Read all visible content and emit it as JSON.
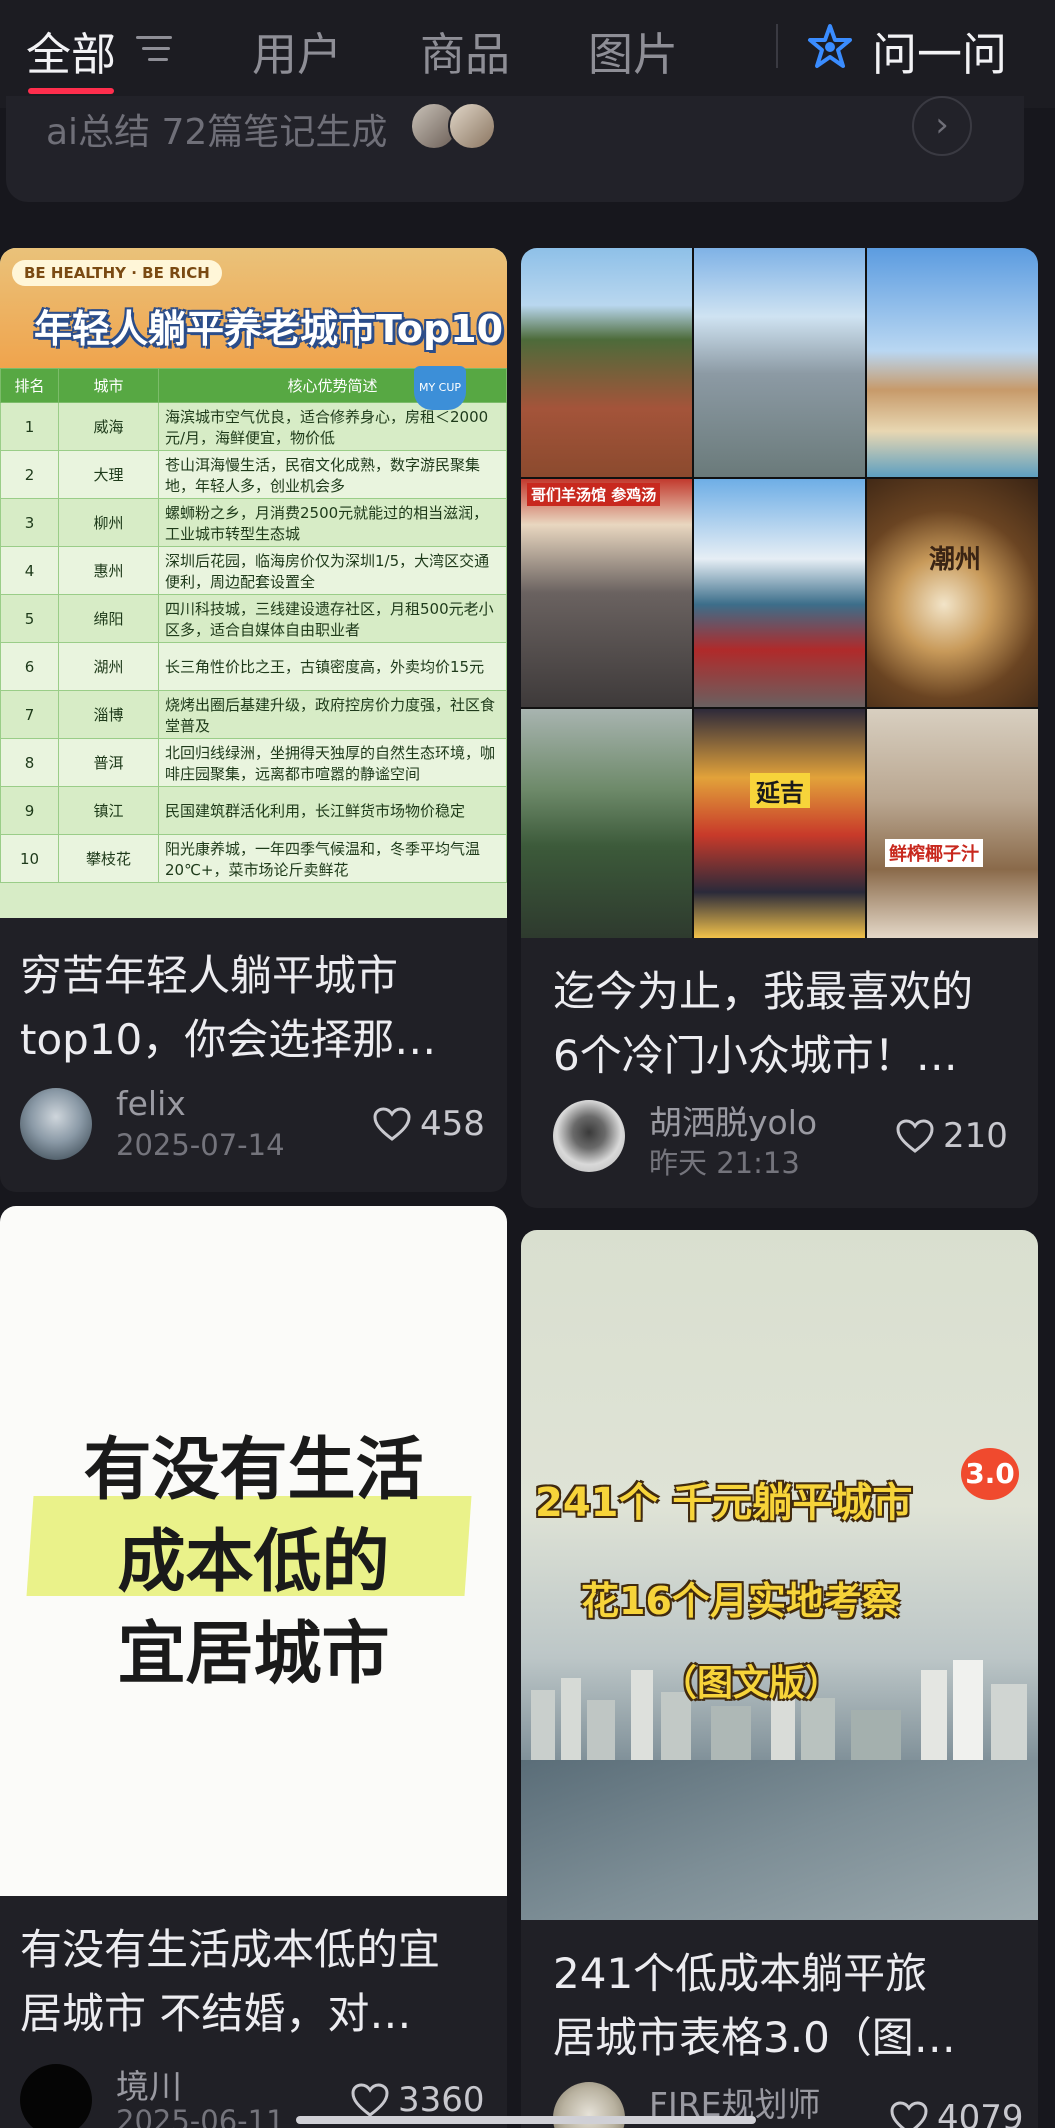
{
  "tabs": [
    {
      "label": "全部",
      "active": true
    },
    {
      "label": "用户",
      "active": false
    },
    {
      "label": "商品",
      "active": false
    },
    {
      "label": "图片",
      "active": false
    }
  ],
  "ask_label": "问一问",
  "ai_summary": {
    "text": "ai总结 72篇笔记生成"
  },
  "cards": [
    {
      "title": "穷苦年轻人躺平城市top10，你会选择那…",
      "title_lines": [
        "穷苦年轻人躺平城市",
        "top10，你会选择那…"
      ],
      "author": "felix",
      "date": "2025-07-14",
      "likes": "458",
      "image": {
        "badge": "BE HEALTHY · BE RICH",
        "heading": "年轻人躺平养老城市Top10",
        "cup_label": "MY CUP",
        "columns": [
          "排名",
          "城市",
          "核心优势简述"
        ],
        "rows": [
          [
            "1",
            "威海",
            "海滨城市空气优良，适合修养身心，房租＜2000元/月，海鲜便宜，物价低"
          ],
          [
            "2",
            "大理",
            "苍山洱海慢生活，民宿文化成熟，数字游民聚集地，年轻人多，创业机会多"
          ],
          [
            "3",
            "柳州",
            "螺蛳粉之乡，月消费2500元就能过的相当滋润，工业城市转型生态城"
          ],
          [
            "4",
            "惠州",
            "深圳后花园，临海房价仅为深圳1/5，大湾区交通便利，周边配套设置全"
          ],
          [
            "5",
            "绵阳",
            "四川科技城，三线建设遗存社区，月租500元老小区多，适合自媒体自由职业者"
          ],
          [
            "6",
            "湖州",
            "长三角性价比之王，古镇密度高，外卖均价15元"
          ],
          [
            "7",
            "淄博",
            "烧烤出圈后基建升级，政府控房价力度强，社区食堂普及"
          ],
          [
            "8",
            "普洱",
            "北回归线绿洲，坐拥得天独厚的自然生态环境，咖啡庄园聚集，远离都市喧嚣的静谧空间"
          ],
          [
            "9",
            "镇江",
            "民国建筑群活化利用，长江鲜货市场物价稳定"
          ],
          [
            "10",
            "攀枝花",
            "阳光康养城，一年四季气候温和，冬季平均气温20℃+，菜市场论斤卖鲜花"
          ]
        ]
      }
    },
    {
      "title": "迄今为止，我最喜欢的6个冷门小众城市！…",
      "title_lines": [
        "迄今为止，我最喜欢的",
        "6个冷门小众城市！…"
      ],
      "author": "胡洒脱yolo",
      "date": "昨天 21:13",
      "likes": "210",
      "image": {
        "photos": [
          {
            "subject": "buddha cliff"
          },
          {
            "subject": "street crossing"
          },
          {
            "subject": "seaside cliff"
          },
          {
            "subject": "market street",
            "sign": "哥们羊汤馆 参鸡汤"
          },
          {
            "subject": "old town buildings"
          },
          {
            "subject": "latte art",
            "sign": "潮州"
          },
          {
            "subject": "hillside village"
          },
          {
            "subject": "neon signs",
            "sign": "延吉"
          },
          {
            "subject": "coconut shop",
            "sign": "鲜榨椰子汁"
          }
        ]
      }
    },
    {
      "title": "有没有生活成本低的宜居城市 不结婚，对…",
      "title_lines": [
        "有没有生活成本低的宜",
        "居城市 不结婚，对…"
      ],
      "author": "境川",
      "date": "2025-06-11",
      "likes": "3360",
      "image": {
        "lines": [
          "有没有生活",
          "成本低的",
          "宜居城市"
        ]
      }
    },
    {
      "title": "241个低成本躺平旅居城市表格3.0（图…",
      "title_lines": [
        "241个低成本躺平旅",
        "居城市表格3.0（图…"
      ],
      "author": "FIRE规划师",
      "date": "",
      "likes": "4079",
      "image": {
        "line1": "241个 千元躺平城市",
        "line2": "花16个月实地考察",
        "line3": "（图文版）",
        "badge": "3.0"
      }
    }
  ],
  "colors": {
    "background": "#17171d",
    "card": "#202026",
    "accent": "#ff2e4d",
    "ask_icon": "#3a8cff"
  }
}
